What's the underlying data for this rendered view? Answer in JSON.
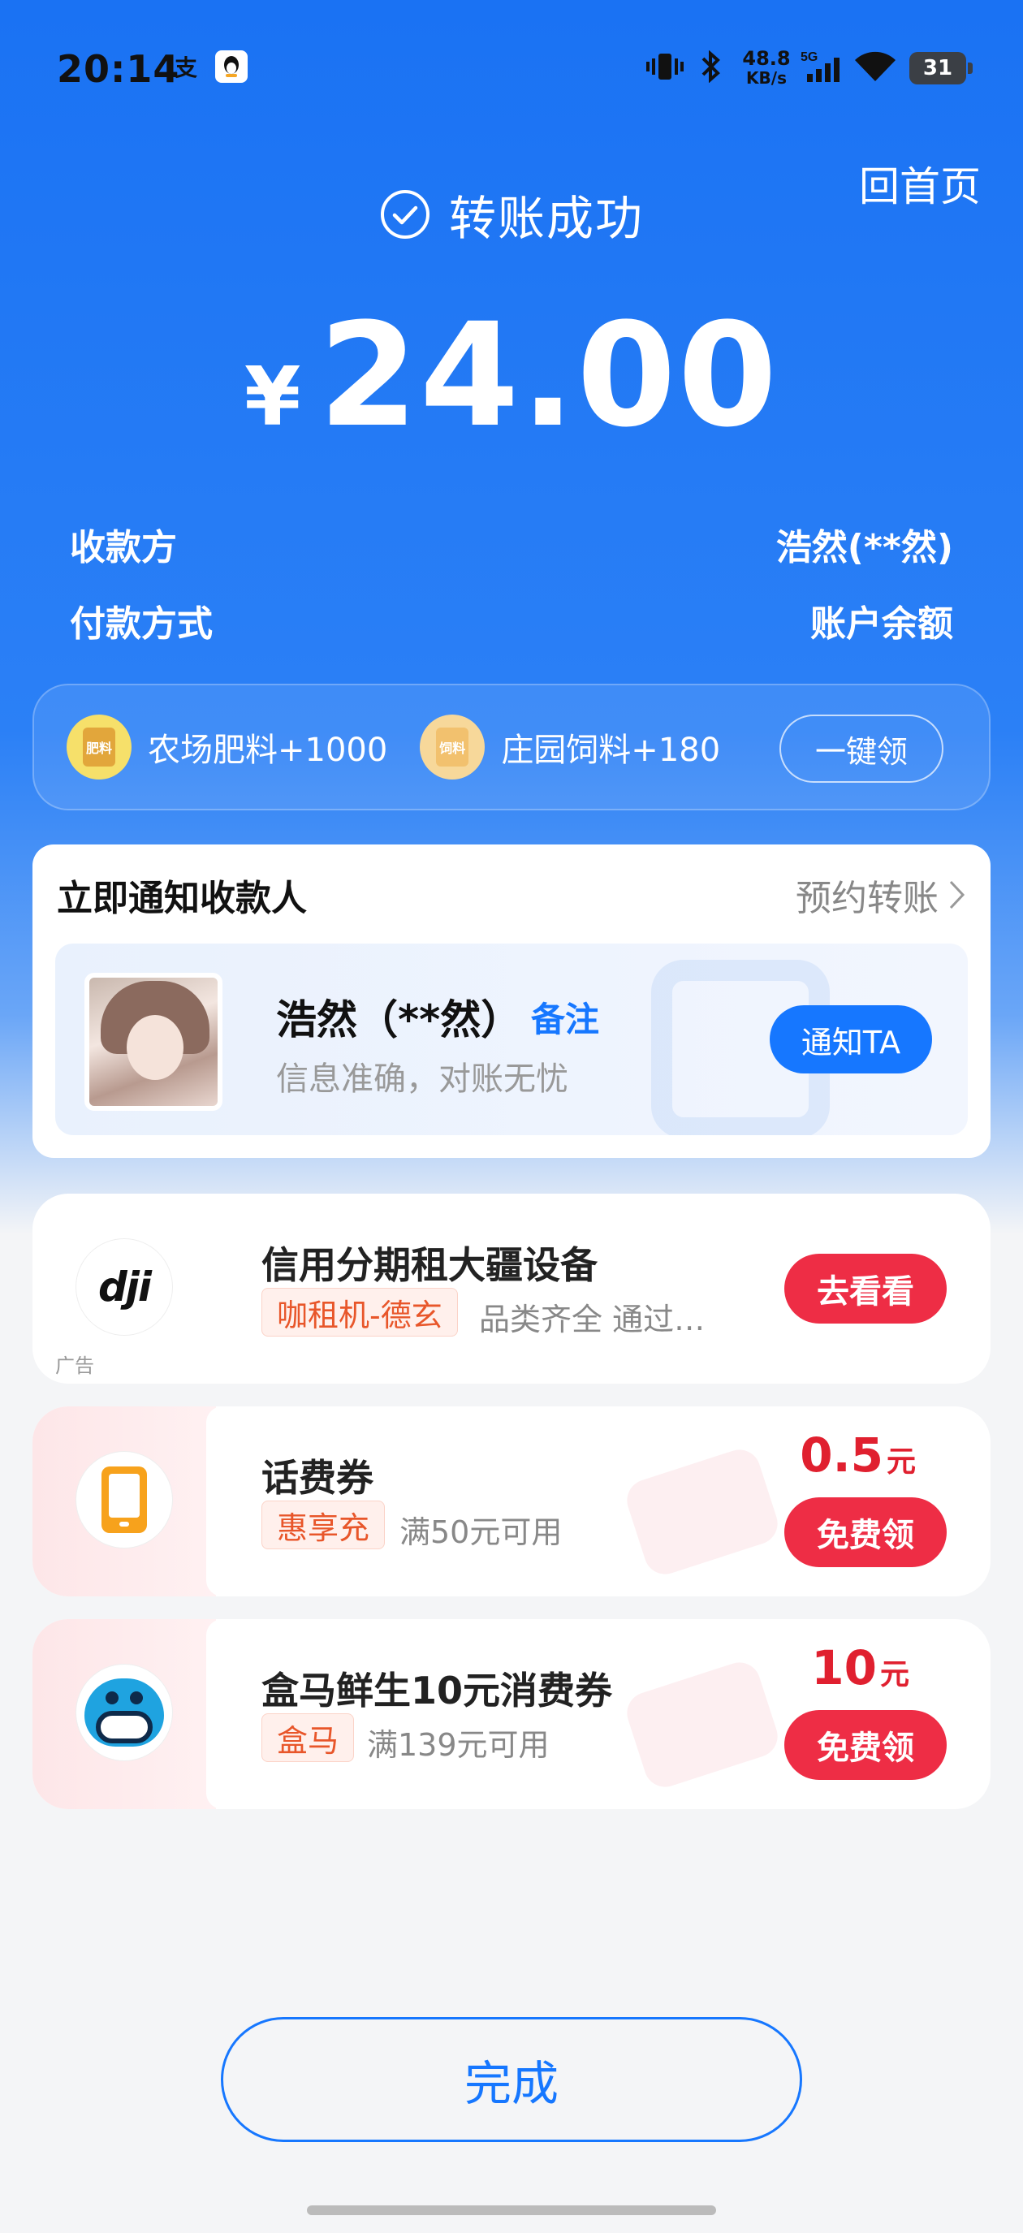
{
  "status_bar": {
    "time": "20:14",
    "alipay_icon": "支",
    "qq_icon": "qq-penguin",
    "net_speed_value": "48.8",
    "net_speed_unit": "KB/s",
    "signal_label": "5G",
    "battery": "31"
  },
  "header": {
    "home_link": "回首页",
    "success_text": "转账成功",
    "currency": "¥",
    "amount": "24.00"
  },
  "details": {
    "payee_label": "收款方",
    "payee_value": "浩然(**然)",
    "method_label": "付款方式",
    "method_value": "账户余额"
  },
  "rewards": {
    "items": [
      {
        "icon_text": "肥料",
        "label": "农场肥料+1000"
      },
      {
        "icon_text": "饲料",
        "label": "庄园饲料+180"
      }
    ],
    "claim_all": "一键领"
  },
  "notify": {
    "title": "立即通知收款人",
    "schedule_link": "预约转账",
    "payee_name": "浩然（**然）",
    "remark": "备注",
    "subtitle": "信息准确，对账无忧",
    "button": "通知TA"
  },
  "ad_card": {
    "logo": "dji",
    "ad_tag": "广告",
    "title": "信用分期租大疆设备",
    "tag": "咖租机-德玄",
    "desc": "品类齐全 通过…",
    "button": "去看看"
  },
  "coupons": [
    {
      "title": "话费券",
      "tag": "惠享充",
      "desc": "满50元可用",
      "value": "0.5",
      "unit": "元",
      "button": "免费领",
      "icon": "phone-icon"
    },
    {
      "title": "盒马鲜生10元消费券",
      "tag": "盒马",
      "desc": "满139元可用",
      "value": "10",
      "unit": "元",
      "button": "免费领",
      "icon": "hippo-icon"
    }
  ],
  "footer": {
    "done_button": "完成"
  },
  "colors": {
    "primary_blue": "#1677ff",
    "header_blue": "#1a72f3",
    "cta_red": "#ee2d45",
    "coupon_red": "#e0202f"
  }
}
